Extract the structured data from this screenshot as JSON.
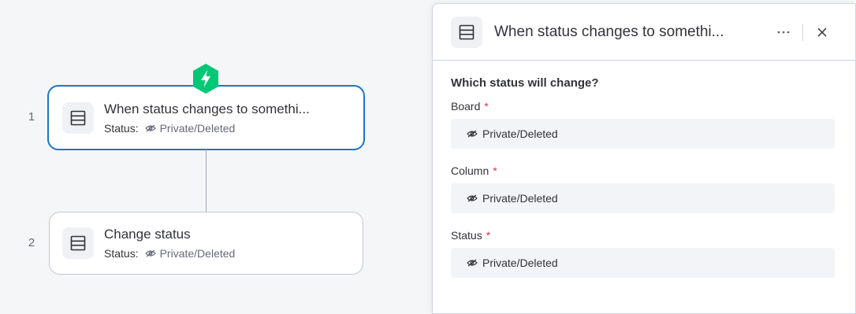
{
  "workflow": {
    "steps": [
      {
        "number": "1",
        "title": "When status changes to somethi...",
        "status_label": "Status:",
        "status_value": "Private/Deleted"
      },
      {
        "number": "2",
        "title": "Change status",
        "status_label": "Status:",
        "status_value": "Private/Deleted"
      }
    ],
    "trigger_icon": "lightning-bolt-icon",
    "accent_color": "#1f76c2",
    "trigger_color": "#00c875"
  },
  "panel": {
    "title": "When status changes to somethi...",
    "question": "Which status will change?",
    "fields": [
      {
        "label": "Board",
        "required_mark": "*",
        "value": "Private/Deleted"
      },
      {
        "label": "Column",
        "required_mark": "*",
        "value": "Private/Deleted"
      },
      {
        "label": "Status",
        "required_mark": "*",
        "value": "Private/Deleted"
      }
    ]
  }
}
